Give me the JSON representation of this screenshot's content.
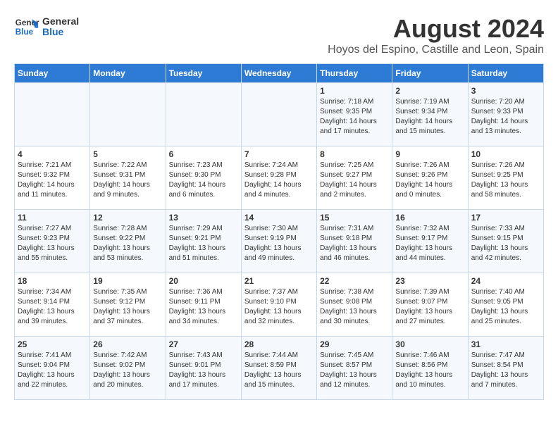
{
  "header": {
    "logo_line1": "General",
    "logo_line2": "Blue",
    "month_year": "August 2024",
    "location": "Hoyos del Espino, Castille and Leon, Spain"
  },
  "days_of_week": [
    "Sunday",
    "Monday",
    "Tuesday",
    "Wednesday",
    "Thursday",
    "Friday",
    "Saturday"
  ],
  "weeks": [
    [
      {
        "day": "",
        "info": ""
      },
      {
        "day": "",
        "info": ""
      },
      {
        "day": "",
        "info": ""
      },
      {
        "day": "",
        "info": ""
      },
      {
        "day": "1",
        "info": "Sunrise: 7:18 AM\nSunset: 9:35 PM\nDaylight: 14 hours\nand 17 minutes."
      },
      {
        "day": "2",
        "info": "Sunrise: 7:19 AM\nSunset: 9:34 PM\nDaylight: 14 hours\nand 15 minutes."
      },
      {
        "day": "3",
        "info": "Sunrise: 7:20 AM\nSunset: 9:33 PM\nDaylight: 14 hours\nand 13 minutes."
      }
    ],
    [
      {
        "day": "4",
        "info": "Sunrise: 7:21 AM\nSunset: 9:32 PM\nDaylight: 14 hours\nand 11 minutes."
      },
      {
        "day": "5",
        "info": "Sunrise: 7:22 AM\nSunset: 9:31 PM\nDaylight: 14 hours\nand 9 minutes."
      },
      {
        "day": "6",
        "info": "Sunrise: 7:23 AM\nSunset: 9:30 PM\nDaylight: 14 hours\nand 6 minutes."
      },
      {
        "day": "7",
        "info": "Sunrise: 7:24 AM\nSunset: 9:28 PM\nDaylight: 14 hours\nand 4 minutes."
      },
      {
        "day": "8",
        "info": "Sunrise: 7:25 AM\nSunset: 9:27 PM\nDaylight: 14 hours\nand 2 minutes."
      },
      {
        "day": "9",
        "info": "Sunrise: 7:26 AM\nSunset: 9:26 PM\nDaylight: 14 hours\nand 0 minutes."
      },
      {
        "day": "10",
        "info": "Sunrise: 7:26 AM\nSunset: 9:25 PM\nDaylight: 13 hours\nand 58 minutes."
      }
    ],
    [
      {
        "day": "11",
        "info": "Sunrise: 7:27 AM\nSunset: 9:23 PM\nDaylight: 13 hours\nand 55 minutes."
      },
      {
        "day": "12",
        "info": "Sunrise: 7:28 AM\nSunset: 9:22 PM\nDaylight: 13 hours\nand 53 minutes."
      },
      {
        "day": "13",
        "info": "Sunrise: 7:29 AM\nSunset: 9:21 PM\nDaylight: 13 hours\nand 51 minutes."
      },
      {
        "day": "14",
        "info": "Sunrise: 7:30 AM\nSunset: 9:19 PM\nDaylight: 13 hours\nand 49 minutes."
      },
      {
        "day": "15",
        "info": "Sunrise: 7:31 AM\nSunset: 9:18 PM\nDaylight: 13 hours\nand 46 minutes."
      },
      {
        "day": "16",
        "info": "Sunrise: 7:32 AM\nSunset: 9:17 PM\nDaylight: 13 hours\nand 44 minutes."
      },
      {
        "day": "17",
        "info": "Sunrise: 7:33 AM\nSunset: 9:15 PM\nDaylight: 13 hours\nand 42 minutes."
      }
    ],
    [
      {
        "day": "18",
        "info": "Sunrise: 7:34 AM\nSunset: 9:14 PM\nDaylight: 13 hours\nand 39 minutes."
      },
      {
        "day": "19",
        "info": "Sunrise: 7:35 AM\nSunset: 9:12 PM\nDaylight: 13 hours\nand 37 minutes."
      },
      {
        "day": "20",
        "info": "Sunrise: 7:36 AM\nSunset: 9:11 PM\nDaylight: 13 hours\nand 34 minutes."
      },
      {
        "day": "21",
        "info": "Sunrise: 7:37 AM\nSunset: 9:10 PM\nDaylight: 13 hours\nand 32 minutes."
      },
      {
        "day": "22",
        "info": "Sunrise: 7:38 AM\nSunset: 9:08 PM\nDaylight: 13 hours\nand 30 minutes."
      },
      {
        "day": "23",
        "info": "Sunrise: 7:39 AM\nSunset: 9:07 PM\nDaylight: 13 hours\nand 27 minutes."
      },
      {
        "day": "24",
        "info": "Sunrise: 7:40 AM\nSunset: 9:05 PM\nDaylight: 13 hours\nand 25 minutes."
      }
    ],
    [
      {
        "day": "25",
        "info": "Sunrise: 7:41 AM\nSunset: 9:04 PM\nDaylight: 13 hours\nand 22 minutes."
      },
      {
        "day": "26",
        "info": "Sunrise: 7:42 AM\nSunset: 9:02 PM\nDaylight: 13 hours\nand 20 minutes."
      },
      {
        "day": "27",
        "info": "Sunrise: 7:43 AM\nSunset: 9:01 PM\nDaylight: 13 hours\nand 17 minutes."
      },
      {
        "day": "28",
        "info": "Sunrise: 7:44 AM\nSunset: 8:59 PM\nDaylight: 13 hours\nand 15 minutes."
      },
      {
        "day": "29",
        "info": "Sunrise: 7:45 AM\nSunset: 8:57 PM\nDaylight: 13 hours\nand 12 minutes."
      },
      {
        "day": "30",
        "info": "Sunrise: 7:46 AM\nSunset: 8:56 PM\nDaylight: 13 hours\nand 10 minutes."
      },
      {
        "day": "31",
        "info": "Sunrise: 7:47 AM\nSunset: 8:54 PM\nDaylight: 13 hours\nand 7 minutes."
      }
    ]
  ]
}
